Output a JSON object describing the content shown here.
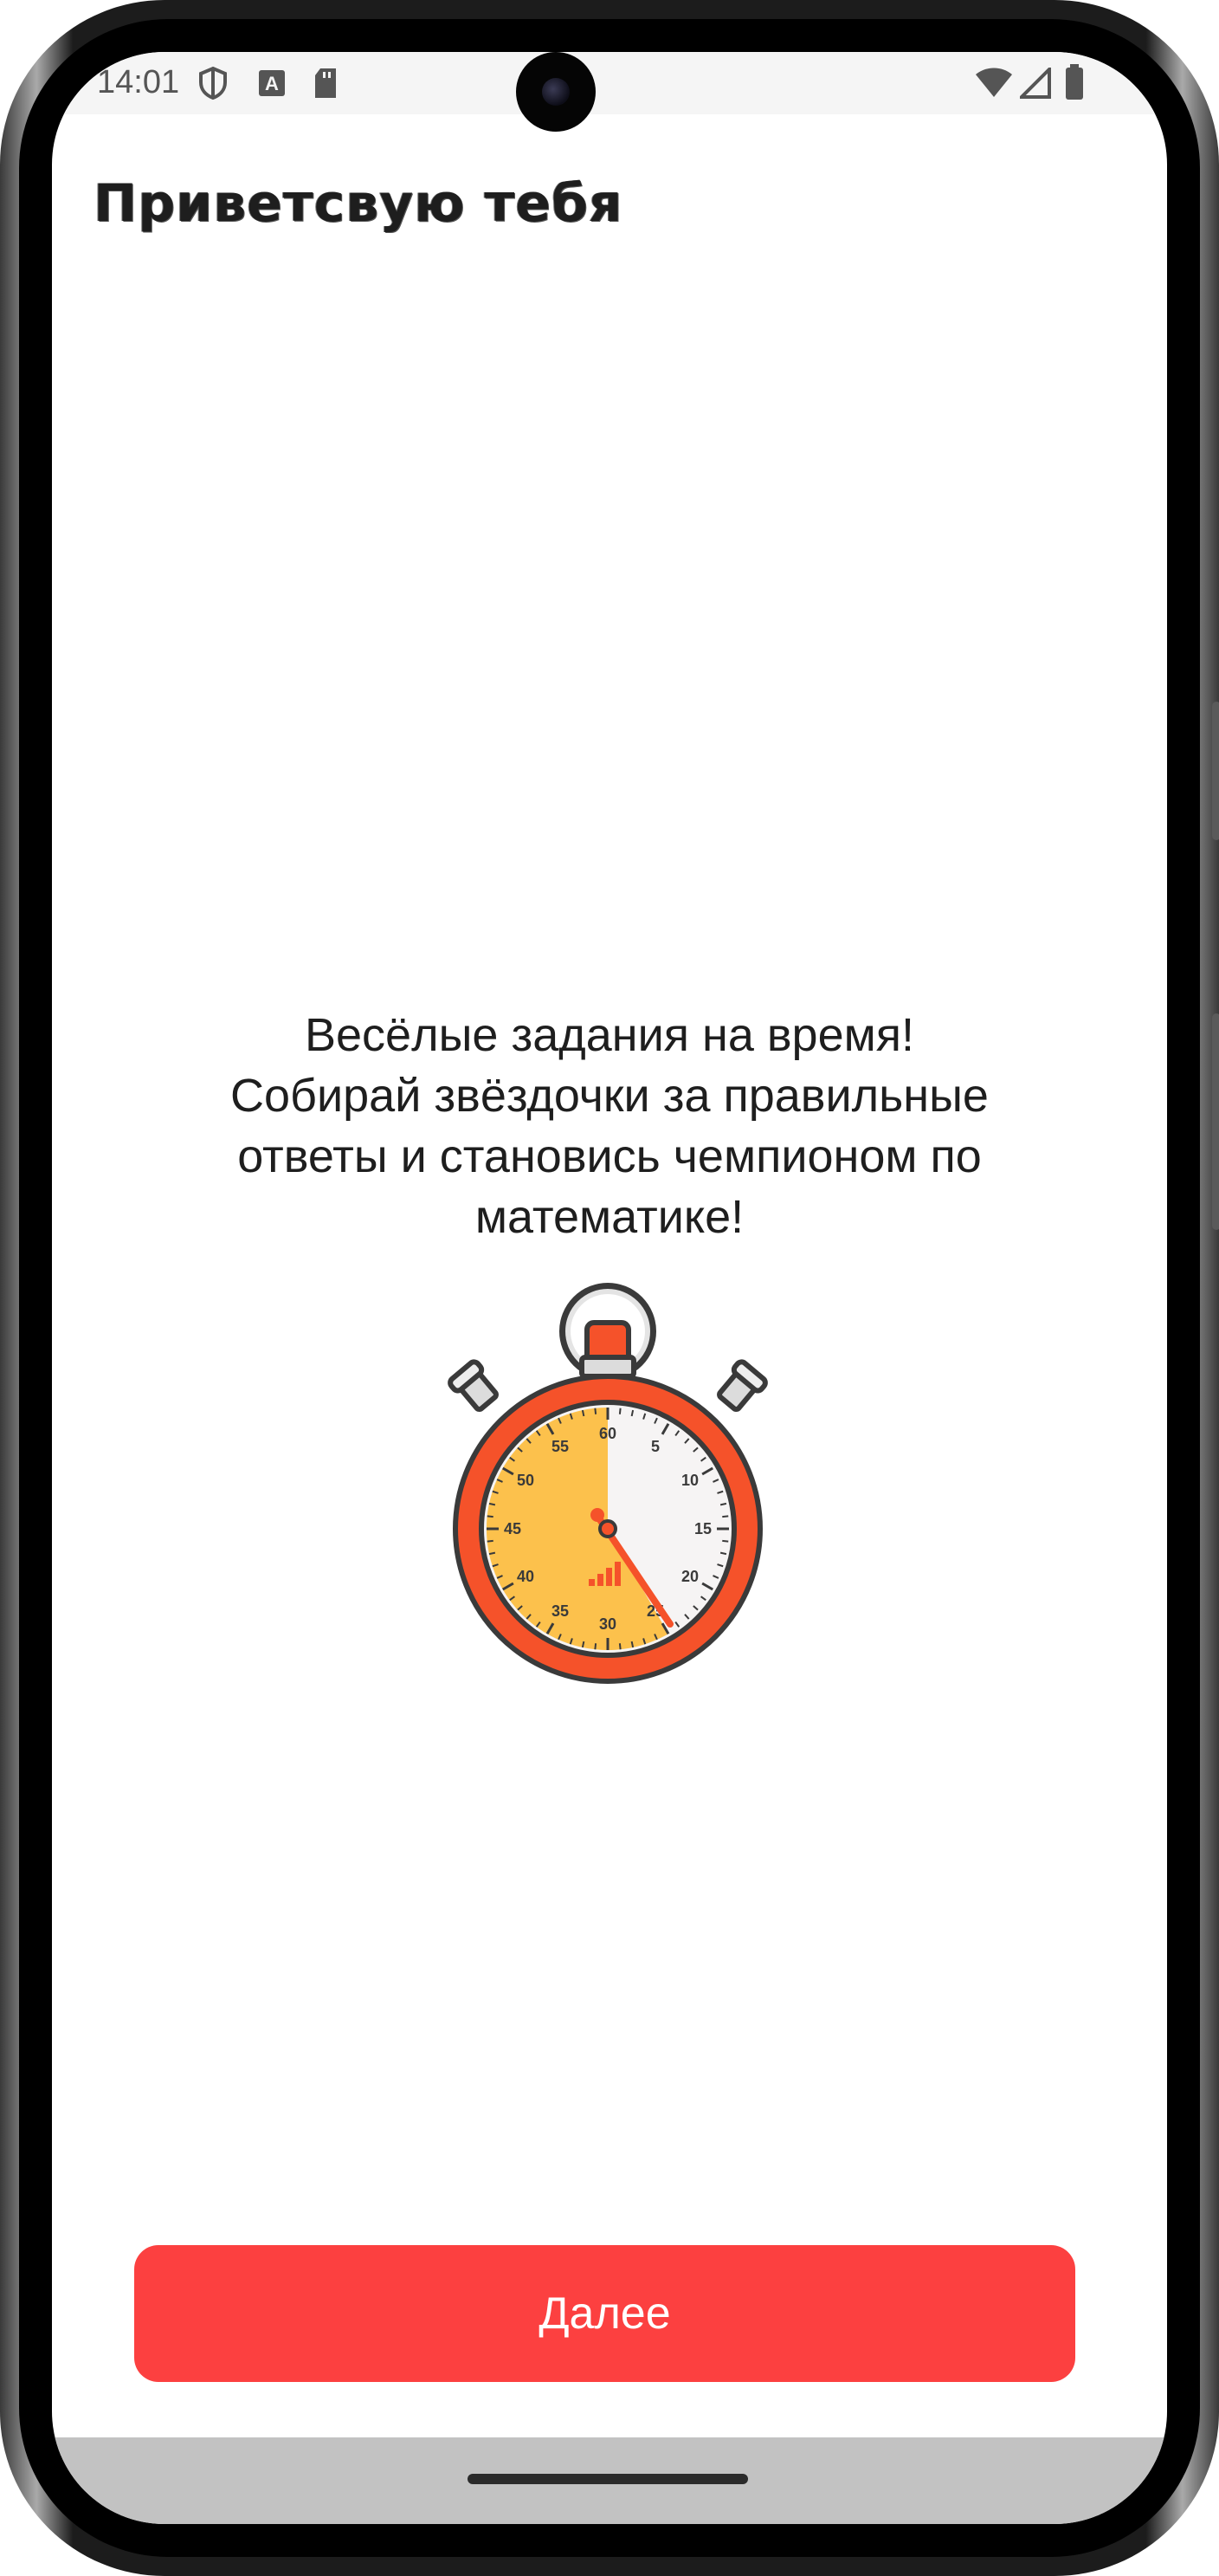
{
  "status_bar": {
    "time": "14:01",
    "icons": [
      "shield-icon",
      "keyboard-a-icon",
      "sd-card-icon",
      "wifi-icon",
      "signal-icon",
      "battery-icon"
    ]
  },
  "header": {
    "greeting": "Приветсвую тебя"
  },
  "main": {
    "description_lines": [
      "Весёлые задания на время!",
      "Собирай звёздочки за правильные",
      "ответы и становись чемпионом по",
      "математике!"
    ],
    "illustration": "stopwatch-icon",
    "stopwatch_labels": [
      "60",
      "5",
      "10",
      "15",
      "20",
      "25",
      "30",
      "35",
      "40",
      "45",
      "50",
      "55"
    ]
  },
  "footer": {
    "next_label": "Далее"
  },
  "colors": {
    "accent": "#fc4040",
    "stopwatch_body": "#f5522a",
    "stopwatch_face_fill": "#fcc14c"
  }
}
